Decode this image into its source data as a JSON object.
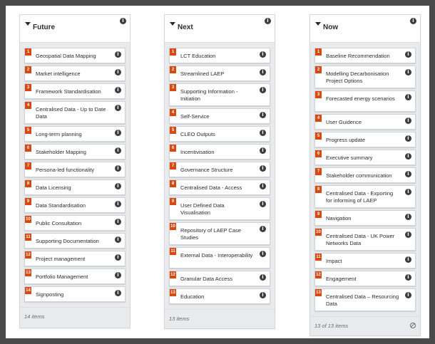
{
  "columns": [
    {
      "title": "Future",
      "footer": "14 items",
      "items": [
        {
          "num": "1",
          "label": "Geospatial Data Mapping"
        },
        {
          "num": "2",
          "label": "Market intelligence"
        },
        {
          "num": "3",
          "label": "Framework Standardisation"
        },
        {
          "num": "4",
          "label": "Centralised Data - Up to Date Data"
        },
        {
          "num": "5",
          "label": "Long-term planning"
        },
        {
          "num": "6",
          "label": "Stakeholder Mapping"
        },
        {
          "num": "7",
          "label": "Persona-led functionality"
        },
        {
          "num": "8",
          "label": "Data Licensing"
        },
        {
          "num": "9",
          "label": "Data Standardisation"
        },
        {
          "num": "10",
          "label": "Public Consultation"
        },
        {
          "num": "11",
          "label": "Supporting Documentation"
        },
        {
          "num": "12",
          "label": "Project management"
        },
        {
          "num": "13",
          "label": "Portfolio Management"
        },
        {
          "num": "14",
          "label": "Signposting"
        }
      ]
    },
    {
      "title": "Next",
      "footer": "13 items",
      "items": [
        {
          "num": "1",
          "label": "LCT Education"
        },
        {
          "num": "2",
          "label": "Streamlined LAEP"
        },
        {
          "num": "3",
          "label": "Supporting Information - Initiation"
        },
        {
          "num": "4",
          "label": "Self-Service"
        },
        {
          "num": "5",
          "label": "CLEO Outputs"
        },
        {
          "num": "6",
          "label": "Incentivisation"
        },
        {
          "num": "7",
          "label": "Governance Structure"
        },
        {
          "num": "8",
          "label": "Centralised Data - Access"
        },
        {
          "num": "9",
          "label": "User Defined Data Visualisation"
        },
        {
          "num": "10",
          "label": "Repository of LAEP Case Studies"
        },
        {
          "num": "11",
          "label": "External Data - Interoperability"
        },
        {
          "num": "12",
          "label": "Granular Data Access"
        },
        {
          "num": "13",
          "label": "Education"
        }
      ]
    },
    {
      "title": "Now",
      "footer": "13 of 13 items",
      "items": [
        {
          "num": "1",
          "label": "Baseline Recommendation"
        },
        {
          "num": "2",
          "label": "Modelling Decarbonisation Project Options"
        },
        {
          "num": "3",
          "label": "Forecasted energy scenarios"
        },
        {
          "num": "4",
          "label": "User Guidence"
        },
        {
          "num": "5",
          "label": "Progress update"
        },
        {
          "num": "6",
          "label": "Executive summary"
        },
        {
          "num": "7",
          "label": "Stakeholder communication"
        },
        {
          "num": "8",
          "label": "Centralised Data - Exporting for informing of LAEP"
        },
        {
          "num": "9",
          "label": "Navigation"
        },
        {
          "num": "10",
          "label": "Centralised Data - UK Power Networks Data"
        },
        {
          "num": "11",
          "label": "Impact"
        },
        {
          "num": "12",
          "label": "Engagement"
        },
        {
          "num": "13",
          "label": "Centralised Data – Resourcing Data"
        }
      ]
    }
  ],
  "colors": {
    "badge": "#d9480f",
    "column_bg": "#e9eaec",
    "frame": "#4a4a4a"
  },
  "icons": {
    "info": "info-icon",
    "collapse": "caret-down-icon",
    "limit": "block-icon"
  },
  "info_glyph": "i"
}
